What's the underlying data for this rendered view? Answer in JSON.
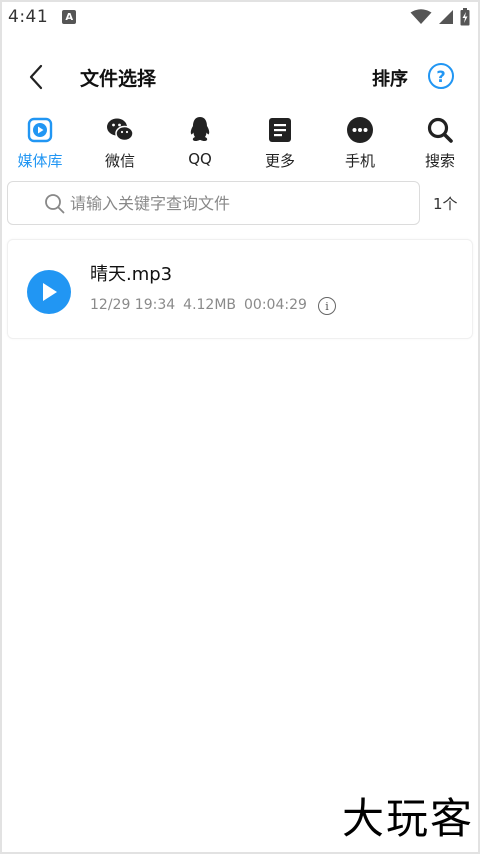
{
  "status_bar": {
    "time": "4:41",
    "notification_badge": "A"
  },
  "header": {
    "title": "文件选择",
    "sort_label": "排序",
    "help_label": "?"
  },
  "tabs": [
    {
      "label": "媒体库",
      "icon": "media-library-icon",
      "active": true
    },
    {
      "label": "微信",
      "icon": "wechat-icon",
      "active": false
    },
    {
      "label": "QQ",
      "icon": "qq-icon",
      "active": false
    },
    {
      "label": "更多",
      "icon": "document-icon",
      "active": false
    },
    {
      "label": "手机",
      "icon": "more-dots-icon",
      "active": false
    },
    {
      "label": "搜索",
      "icon": "search-icon",
      "active": false
    }
  ],
  "search": {
    "placeholder": "请输入关键字查询文件",
    "value": "",
    "count": "1个"
  },
  "files": [
    {
      "name": "晴天.mp3",
      "date": "12/29 19:34",
      "size": "4.12MB",
      "duration": "00:04:29"
    }
  ],
  "watermark": "大玩客",
  "colors": {
    "accent": "#2196f3",
    "text": "#111111",
    "meta": "#8a8a8a"
  }
}
